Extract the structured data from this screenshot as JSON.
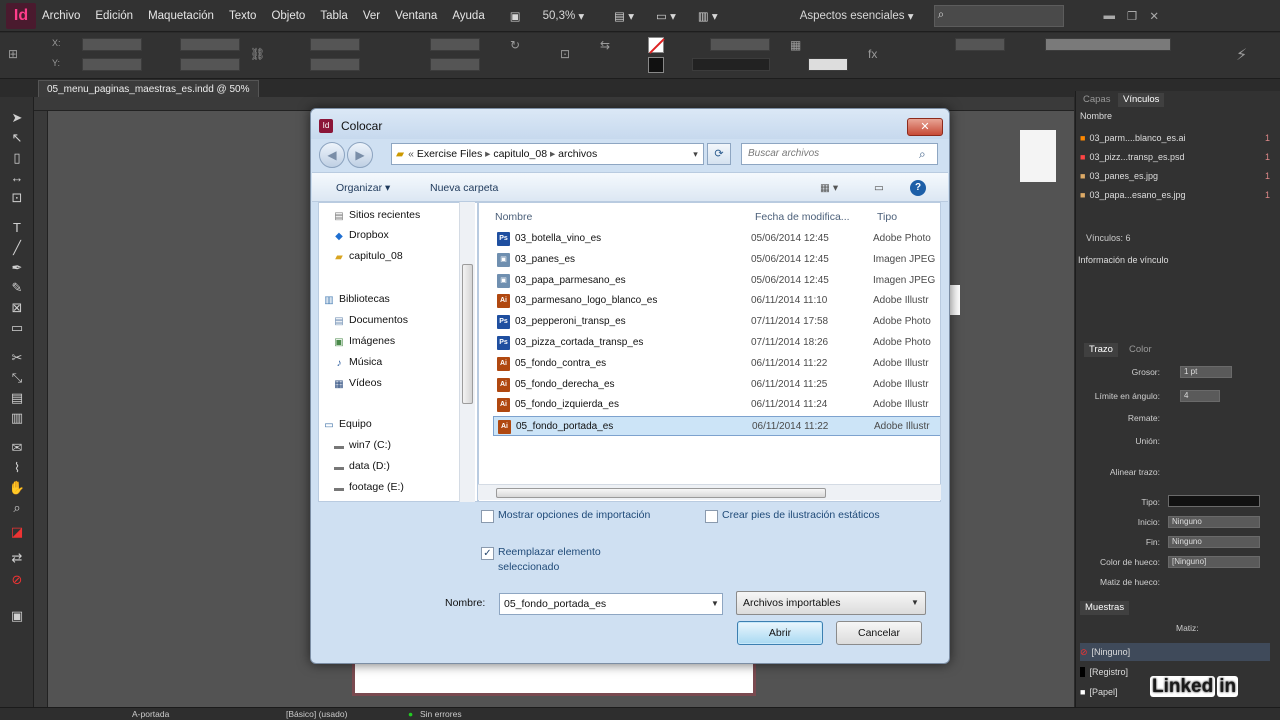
{
  "menubar": {
    "logo": "Id",
    "items": [
      "Archivo",
      "Edición",
      "Maquetación",
      "Texto",
      "Objeto",
      "Tabla",
      "Ver",
      "Ventana",
      "Ayuda"
    ],
    "zoom": "50,3%",
    "workspace": "Aspectos esenciales"
  },
  "doc_tab": "05_menu_paginas_maestras_es.indd @ 50%",
  "links_panel": {
    "tabs": [
      "Capas",
      "Vínculos"
    ],
    "header": "Nombre",
    "rows": [
      {
        "name": "03_parm....blanco_es.ai",
        "num": "1"
      },
      {
        "name": "03_pizz...transp_es.psd",
        "num": "1"
      },
      {
        "name": "03_panes_es.jpg",
        "num": "1"
      },
      {
        "name": "03_papa...esano_es.jpg",
        "num": "1"
      }
    ],
    "count": "Vínculos: 6",
    "info": "Información de vínculo"
  },
  "stroke_panel": {
    "tabs": [
      "Trazo",
      "Color"
    ],
    "labels": [
      "Grosor:",
      "Límite en ángulo:",
      "Remate:",
      "Unión:",
      "Alinear trazo:",
      "Tipo:",
      "Inicio:",
      "Fin:",
      "Color de hueco:",
      "Matiz de hueco:"
    ],
    "grosor": "1 pt",
    "limite": "4",
    "inicio": "Ninguno",
    "fin": "Ninguno",
    "color_hueco": "[Ninguno]"
  },
  "swatches_panel": {
    "tab": "Muestras",
    "matiz_label": "Matiz:",
    "rows": [
      "[Ninguno]",
      "[Registro]",
      "[Papel]"
    ]
  },
  "status": {
    "page": "A-portada",
    "style": "[Básico] (usado)",
    "errors": "Sin errores"
  },
  "dialog": {
    "title": "Colocar",
    "path": [
      "Exercise Files",
      "capitulo_08",
      "archivos"
    ],
    "search_placeholder": "Buscar archivos",
    "organize": "Organizar",
    "new_folder": "Nueva carpeta",
    "nav": {
      "recent": "Sitios recientes",
      "dropbox": "Dropbox",
      "chapter": "capitulo_08",
      "libraries": "Bibliotecas",
      "documents": "Documentos",
      "images": "Imágenes",
      "music": "Música",
      "videos": "Vídeos",
      "computer": "Equipo",
      "drive_c": "win7 (C:)",
      "drive_d": "data (D:)",
      "drive_e": "footage (E:)"
    },
    "columns": {
      "name": "Nombre",
      "date": "Fecha de modifica...",
      "type": "Tipo"
    },
    "files": [
      {
        "name": "03_botella_vino_es",
        "date": "05/06/2014 12:45",
        "type": "Adobe Photo",
        "kind": "psd"
      },
      {
        "name": "03_panes_es",
        "date": "05/06/2014 12:45",
        "type": "Imagen JPEG",
        "kind": "jpg"
      },
      {
        "name": "03_papa_parmesano_es",
        "date": "05/06/2014 12:45",
        "type": "Imagen JPEG",
        "kind": "jpg"
      },
      {
        "name": "03_parmesano_logo_blanco_es",
        "date": "06/11/2014 11:10",
        "type": "Adobe Illustr",
        "kind": "ai"
      },
      {
        "name": "03_pepperoni_transp_es",
        "date": "07/11/2014 17:58",
        "type": "Adobe Photo",
        "kind": "psd"
      },
      {
        "name": "03_pizza_cortada_transp_es",
        "date": "07/11/2014 18:26",
        "type": "Adobe Photo",
        "kind": "psd"
      },
      {
        "name": "05_fondo_contra_es",
        "date": "06/11/2014 11:22",
        "type": "Adobe Illustr",
        "kind": "ai"
      },
      {
        "name": "05_fondo_derecha_es",
        "date": "06/11/2014 11:25",
        "type": "Adobe Illustr",
        "kind": "ai"
      },
      {
        "name": "05_fondo_izquierda_es",
        "date": "06/11/2014 11:24",
        "type": "Adobe Illustr",
        "kind": "ai"
      },
      {
        "name": "05_fondo_portada_es",
        "date": "06/11/2014 11:22",
        "type": "Adobe Illustr",
        "kind": "ai",
        "selected": true
      }
    ],
    "options": {
      "show_import": "Mostrar opciones de importación",
      "replace": "Reemplazar elemento seleccionado",
      "captions": "Crear pies de ilustración estáticos"
    },
    "name_label": "Nombre:",
    "name_value": "05_fondo_portada_es",
    "file_type": "Archivos importables",
    "open": "Abrir",
    "cancel": "Cancelar"
  },
  "watermark": "Linked"
}
